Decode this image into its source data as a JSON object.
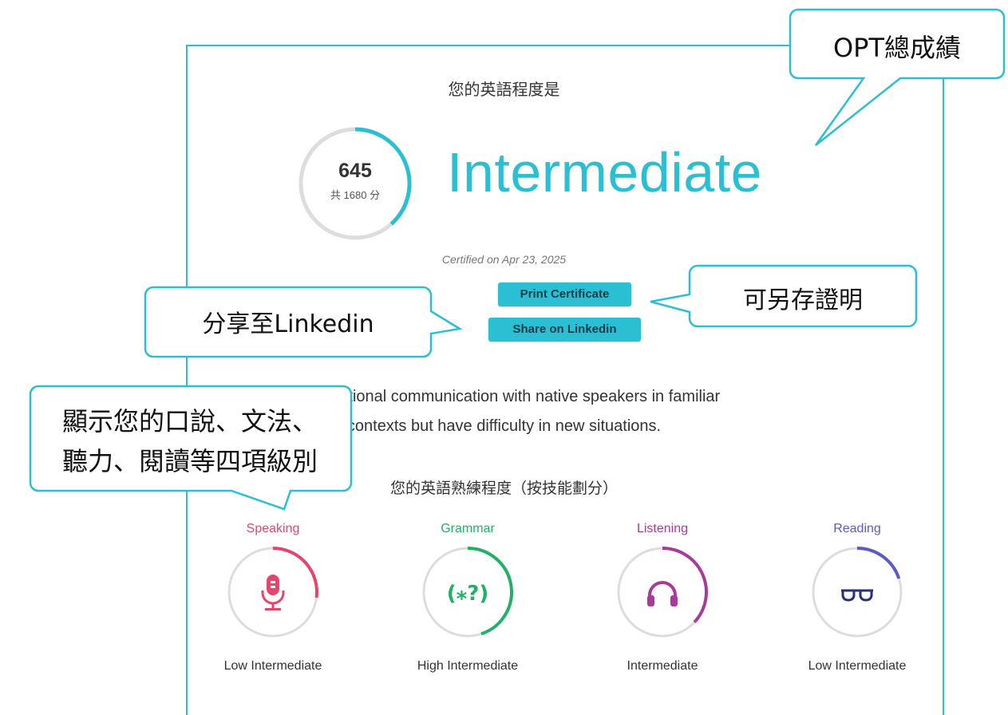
{
  "header_label": "您的英語程度是",
  "score": {
    "value": "645",
    "total_text": "共 1680 分",
    "fraction": 0.384
  },
  "level": "Intermediate",
  "certified": "Certified on Apr 23, 2025",
  "buttons": {
    "print": "Print Certificate",
    "share": "Share on Linkedin"
  },
  "description": {
    "line1": "ave functional communication with native speakers in familiar",
    "line2": "contexts but have difficulty in new situations."
  },
  "skills_heading": "您的英語熟練程度（按技能劃分）",
  "skills": [
    {
      "name": "Speaking",
      "level": "Low Intermediate",
      "color": "#e8436b",
      "fraction": 0.27,
      "icon": "microphone-icon"
    },
    {
      "name": "Grammar",
      "level": "High Intermediate",
      "color": "#21b068",
      "fraction": 0.45,
      "icon": "grammar-symbols-icon"
    },
    {
      "name": "Listening",
      "level": "Intermediate",
      "color": "#a83a9b",
      "fraction": 0.37,
      "icon": "headphones-icon"
    },
    {
      "name": "Reading",
      "level": "Low Intermediate",
      "color": "#5a5bc6",
      "fraction": 0.2,
      "icon": "glasses-icon"
    }
  ],
  "callouts": {
    "opt": "OPT總成績",
    "linkedin": "分享至Linkedin",
    "save": "可另存證明",
    "skills_line1": "顯示您的口說、文法、",
    "skills_line2": "聽力、閱讀等四項級別"
  },
  "colors": {
    "accent": "#2bbfd3",
    "ring_bg": "#dddddd"
  }
}
